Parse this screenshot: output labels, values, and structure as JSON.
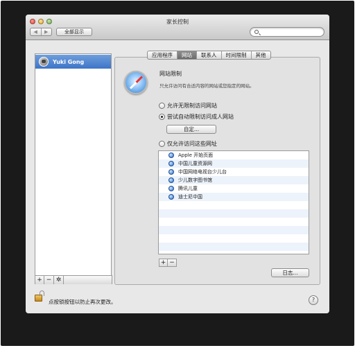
{
  "window": {
    "title": "家长控制"
  },
  "toolbar": {
    "back_glyph": "◀",
    "forward_glyph": "▶",
    "show_all_label": "全部显示",
    "search_placeholder": ""
  },
  "sidebar": {
    "users": [
      {
        "name": "Yuki Gong",
        "selected": true
      }
    ],
    "add_glyph": "+",
    "remove_glyph": "−",
    "gear_glyph": "✲"
  },
  "tabs": [
    {
      "label": "应用程序",
      "active": false
    },
    {
      "label": "网站",
      "active": true
    },
    {
      "label": "联系人",
      "active": false
    },
    {
      "label": "时间限制",
      "active": false
    },
    {
      "label": "其他",
      "active": false
    }
  ],
  "website": {
    "title": "网站限制",
    "description": "只允许访问有合适内容的网站或您指定的网站。",
    "options": [
      {
        "label": "允许无限制访问网站",
        "checked": false
      },
      {
        "label": "尝试自动限制访问成人网站",
        "checked": true
      },
      {
        "label": "仅允许访问这些网址",
        "checked": false
      }
    ],
    "customize_label": "自定...",
    "sites": [
      "Apple 开始页面",
      "中国儿童资源网",
      "中国网络电视台少儿台",
      "少儿数字图书馆",
      "腾讯儿童",
      "迪士尼中国"
    ],
    "add_glyph": "+",
    "remove_glyph": "−",
    "log_label": "日志..."
  },
  "footer": {
    "lock_text": "点按锁按钮以防止再次更改。",
    "help_glyph": "?"
  },
  "colors": {
    "selection": "#4a80cc",
    "active_tab": "#7a7a7a",
    "window_bg": "#e8e8e8"
  }
}
